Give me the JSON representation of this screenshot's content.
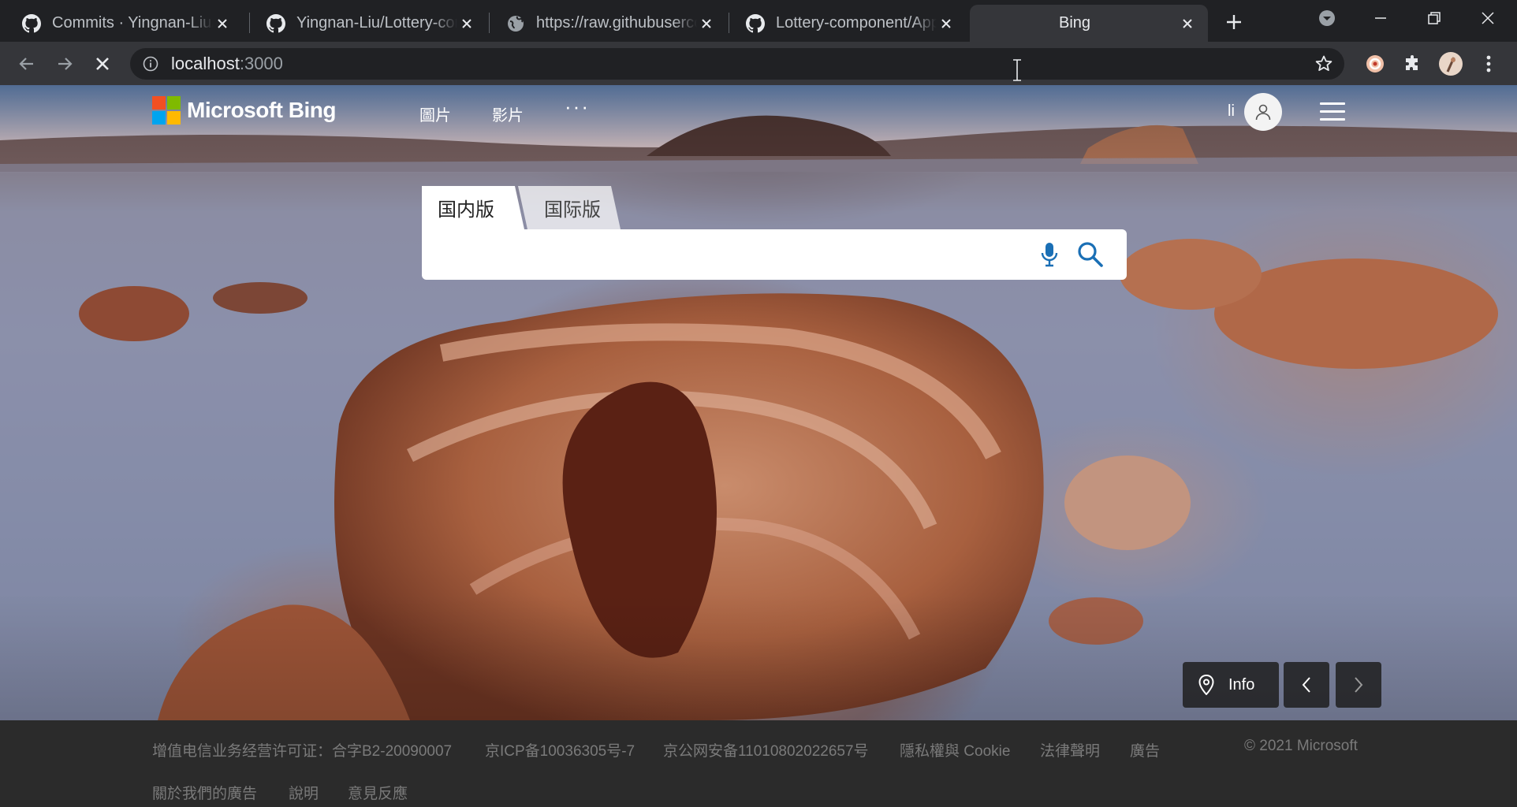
{
  "browser": {
    "tabs": [
      {
        "title": "Commits · Yingnan-Liu/Lottery-component",
        "favicon": "github-icon",
        "active": false
      },
      {
        "title": "Yingnan-Liu/Lottery-component",
        "favicon": "github-icon",
        "active": false
      },
      {
        "title": "https://raw.githubusercontent.com",
        "favicon": "globe-icon",
        "active": false
      },
      {
        "title": "Lottery-component/App.js",
        "favicon": "github-icon",
        "active": false
      },
      {
        "title": "Bing",
        "favicon": "",
        "active": true
      }
    ],
    "address": {
      "host": "localhost",
      "port": ":3000"
    }
  },
  "bing": {
    "logo_text": "Microsoft Bing",
    "nav": {
      "images": "圖片",
      "videos": "影片",
      "more": "···"
    },
    "user_name": "li",
    "search_tabs": {
      "domestic": "国内版",
      "international": "国际版"
    },
    "search": {
      "value": "",
      "placeholder": ""
    },
    "info_label": "Info"
  },
  "footer": {
    "links": [
      "增值电信业务经营许可证：合字B2-20090007",
      "京ICP备10036305号-7",
      "京公网安备11010802022657号",
      "隱私權與 Cookie",
      "法律聲明",
      "廣告",
      "© 2021 Microsoft",
      "關於我們的廣告",
      "說明",
      "意見反應"
    ]
  },
  "colors": {
    "chrome_dark": "#202124",
    "chrome_toolbar": "#35363a",
    "ms_red": "#f25022",
    "ms_green": "#7fba00",
    "ms_blue": "#00a4ef",
    "ms_yellow": "#ffb900",
    "bing_icon_blue": "#1a6fb5",
    "footer_bg": "#2b2b2b"
  }
}
